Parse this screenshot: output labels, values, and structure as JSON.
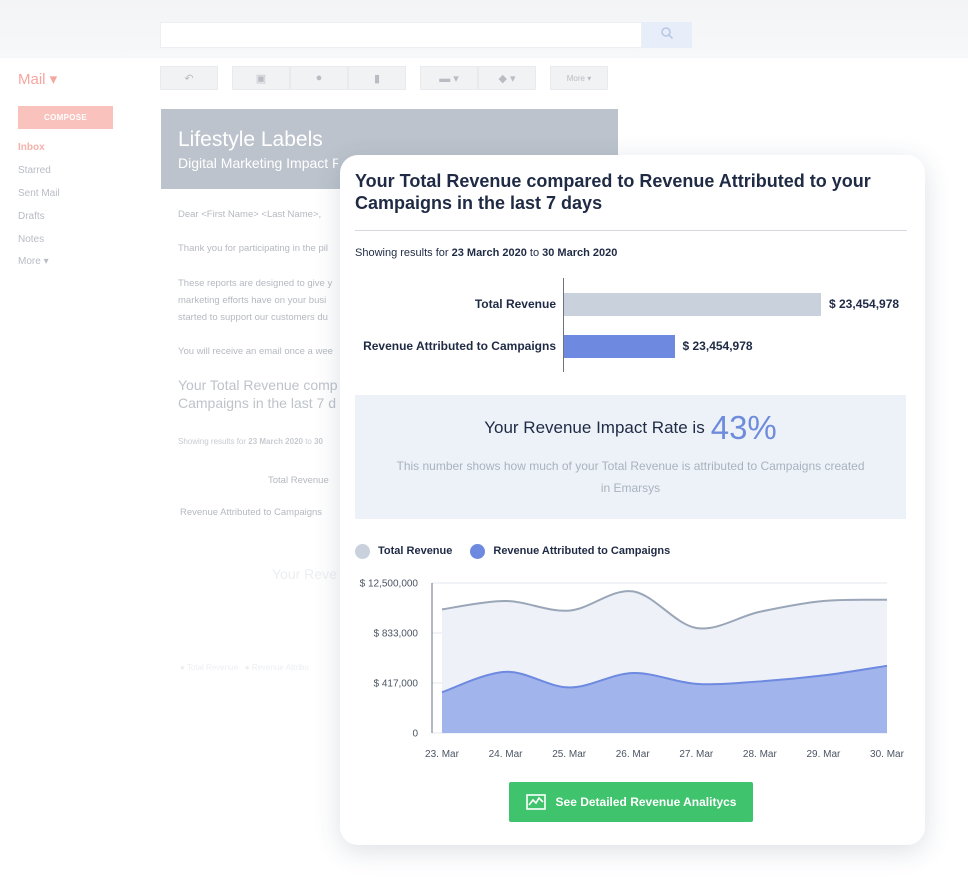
{
  "mail": {
    "logo": "Mail",
    "compose_label": "COMPOSE",
    "more_toolbar_label": "More",
    "nav": [
      "Inbox",
      "Starred",
      "Sent Mail",
      "Drafts",
      "Notes",
      "More"
    ]
  },
  "email": {
    "title": "Lifestyle Labels",
    "subtitle": "Digital Marketing Impact R",
    "greeting": "Dear <First Name> <Last Name>,",
    "line1": "Thank you for participating in the pil",
    "line2": "These reports are designed to give y",
    "line3": "marketing efforts have on your busi",
    "line4": "started to support our customers du",
    "line5": "You will receive an email once a wee",
    "heading_line1": "Your Total Revenue comp",
    "heading_line2": "Campaigns in the last 7 d",
    "results_prefix": "Showing results for",
    "results_from": "23 March 2020",
    "results_to_word": "to",
    "results_to": "30",
    "total_label": "Total Revenue",
    "campaign_label": "Revenue Attributed to Campaigns",
    "faint_title": "Your Reve",
    "faint_legend_total": "Total Revenue",
    "faint_legend_campaign": "Revenue Attribu"
  },
  "card": {
    "title": "Your Total Revenue compared to Revenue Attributed to your Campaigns in the last 7 days",
    "range_prefix": "Showing results for",
    "range_from": "23 March 2020",
    "range_to_word": "to",
    "range_to": "30 March 2020",
    "impact_text": "Your Revenue Impact Rate is",
    "impact_rate": "43%",
    "impact_description": "This number shows how much of your Total Revenue is attributed to Campaigns created in Emarsys",
    "cta_label": "See Detailed Revenue Analitycs"
  },
  "colors": {
    "total": "#c9d1dd",
    "campaign": "#6e89e0",
    "accent": "#6f8cdc",
    "cta": "#3fc36c"
  },
  "icons": {
    "search": "search-icon",
    "cta": "analytics-chart-icon"
  },
  "chart_data": [
    {
      "type": "bar",
      "orientation": "horizontal",
      "categories": [
        "Total Revenue",
        "Revenue Attributed to Campaigns"
      ],
      "value_labels": [
        "$ 23,454,978",
        "$ 23,454,978"
      ],
      "values": [
        23454978,
        10085640
      ]
    },
    {
      "type": "area",
      "x": [
        "23. Mar",
        "24. Mar",
        "25. Mar",
        "26. Mar",
        "27. Mar",
        "28. Mar",
        "29. Mar",
        "30. Mar"
      ],
      "y_ticks": [
        "$ 12,500,000",
        "$ 833,000",
        "$ 417,000",
        "0"
      ],
      "grid": true,
      "legend_position": "top-left",
      "series": [
        {
          "name": "Total Revenue",
          "values": [
            1030000,
            1100000,
            1020000,
            1180000,
            875000,
            1010000,
            1100000,
            1110000
          ]
        },
        {
          "name": "Revenue Attributed to Campaigns",
          "values": [
            340000,
            510000,
            380000,
            500000,
            410000,
            430000,
            480000,
            560000
          ]
        }
      ]
    }
  ]
}
